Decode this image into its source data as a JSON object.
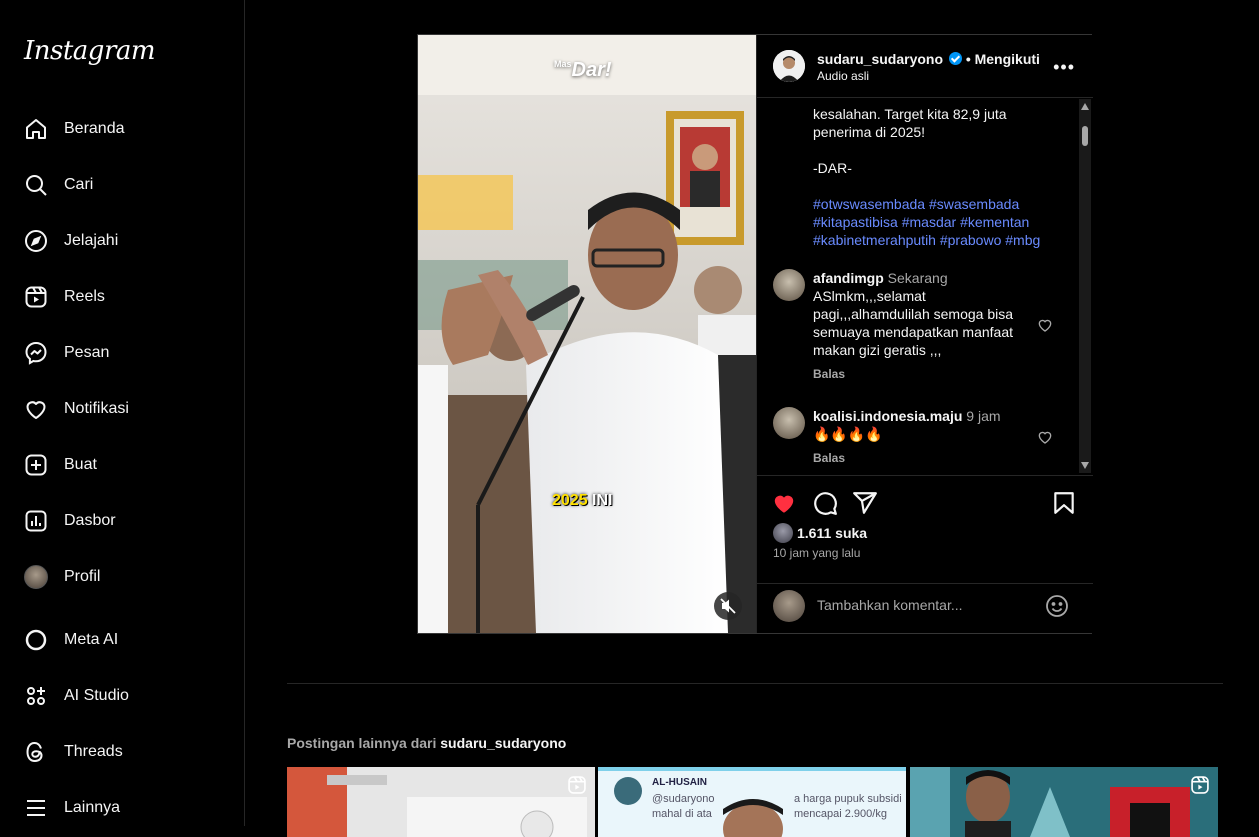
{
  "app": {
    "logo": "Instagram"
  },
  "sidebar": {
    "items": [
      {
        "label": "Beranda",
        "icon": "home-icon"
      },
      {
        "label": "Cari",
        "icon": "search-icon"
      },
      {
        "label": "Jelajahi",
        "icon": "compass-icon"
      },
      {
        "label": "Reels",
        "icon": "reels-icon"
      },
      {
        "label": "Pesan",
        "icon": "messenger-icon"
      },
      {
        "label": "Notifikasi",
        "icon": "heart-icon"
      },
      {
        "label": "Buat",
        "icon": "plus-square-icon"
      },
      {
        "label": "Dasbor",
        "icon": "dashboard-icon"
      },
      {
        "label": "Profil",
        "icon": "avatar"
      },
      {
        "label": "Meta AI",
        "icon": "meta-ai-icon"
      },
      {
        "label": "AI Studio",
        "icon": "ai-studio-icon"
      },
      {
        "label": "Threads",
        "icon": "threads-icon"
      },
      {
        "label": "Lainnya",
        "icon": "menu-icon"
      }
    ]
  },
  "post": {
    "username": "sudaru_sudaryono",
    "separator": "•",
    "follow_status": "Mengikuti",
    "audio": "Audio asli",
    "video": {
      "logo_text": "Dar!",
      "logo_prefix": "Mas",
      "subtitle_highlight": "2025",
      "subtitle_rest": " INI"
    },
    "caption_lines": [
      "kesalahan. Target kita 82,9 juta",
      "penerima di 2025!",
      "",
      "-DAR-"
    ],
    "caption_tags": "#otwswasembada #swasembada #kitapastibisa #masdar #kementan #kabinetmerahputih #prabowo #mbg",
    "comments": [
      {
        "user": "afandimgp",
        "time": "Sekarang",
        "text": "ASlmkm,,,selamat pagi,,,alhamdulilah semoga bisa semuaya mendapatkan manfaat makan gizi geratis ,,,",
        "reply": "Balas"
      },
      {
        "user": "koalisi.indonesia.maju",
        "time": "9 jam",
        "text": "🔥🔥🔥🔥",
        "reply": "Balas"
      }
    ],
    "likes": "1.611 suka",
    "posted_ago": "10 jam yang lalu",
    "add_comment_placeholder": "Tambahkan komentar...",
    "liked": true,
    "like_color": "#ff3040"
  },
  "more_posts": {
    "prefix": "Postingan lainnya dari",
    "username": "sudaru_sudaryono",
    "thumbs": [
      {
        "caption": ""
      },
      {
        "account": "AL-HUSAIN",
        "line1": "@sudaryono",
        "line2": "a harga pupuk subsidi",
        "line3": "mahal di ata",
        "line4": "mencapai 2.900/kg"
      },
      {
        "caption": ""
      }
    ]
  },
  "colors": {
    "background": "#000000",
    "accent_blue": "#0095f6",
    "hashtag": "#6a8bff",
    "border": "#262626"
  }
}
